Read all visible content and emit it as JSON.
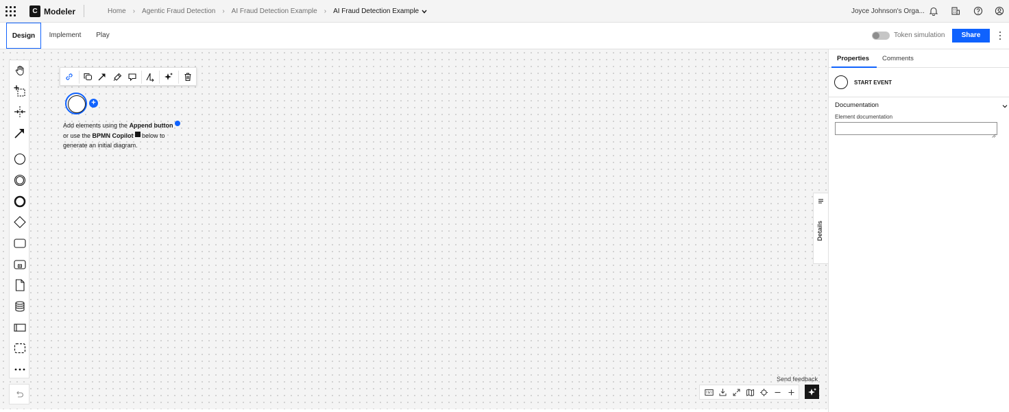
{
  "header": {
    "app_name": "Modeler",
    "logo_letter": "C",
    "breadcrumbs": [
      "Home",
      "Agentic Fraud Detection",
      "AI Fraud Detection Example"
    ],
    "current_file": "AI Fraud Detection Example",
    "organization": "Joyce Johnson's Orga..."
  },
  "tabs": [
    {
      "label": "Design",
      "active": true
    },
    {
      "label": "Implement",
      "active": false
    },
    {
      "label": "Play",
      "active": false
    }
  ],
  "toolbar": {
    "token_simulation_label": "Token simulation",
    "token_simulation_enabled": false,
    "share_label": "Share"
  },
  "palette": {
    "items": [
      "hand-tool-icon",
      "lasso-tool-icon",
      "space-tool-icon",
      "global-connect-icon",
      "start-event-icon",
      "intermediate-event-icon",
      "end-event-icon",
      "gateway-icon",
      "task-icon",
      "subprocess-icon",
      "data-object-icon",
      "data-store-icon",
      "pool-icon",
      "group-icon",
      "more-icon"
    ]
  },
  "canvas": {
    "context_pad": [
      "link-icon",
      "copy-icon",
      "connect-icon",
      "format-icon",
      "comment-icon",
      "change-type-icon",
      "copilot-icon",
      "delete-icon"
    ],
    "hint": {
      "part1": "Add elements using the ",
      "append": "Append button",
      "part2": "or use the ",
      "copilot": "BPMN Copilot",
      "part3": " below to",
      "part4": "generate an initial diagram."
    },
    "details_label": "Details",
    "feedback_label": "Send feedback",
    "zoom_controls": [
      "keyboard-icon",
      "download-icon",
      "fullscreen-icon",
      "minimap-icon",
      "recenter-icon",
      "zoom-out-icon",
      "zoom-in-icon"
    ]
  },
  "panel": {
    "tabs": [
      {
        "label": "Properties",
        "active": true
      },
      {
        "label": "Comments",
        "active": false
      }
    ],
    "element_type": "START EVENT",
    "section_title": "Documentation",
    "field_label": "Element documentation",
    "field_value": ""
  },
  "colors": {
    "accent": "#0f62fe",
    "text": "#161616",
    "canvas_bg": "#f4f4f4"
  }
}
